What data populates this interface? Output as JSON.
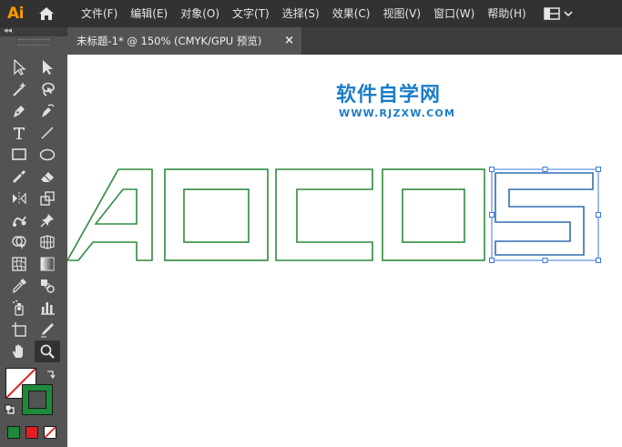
{
  "app": {
    "logo_text": "Ai",
    "brand_color": "#FF9A00"
  },
  "menu": {
    "items": [
      "文件(F)",
      "编辑(E)",
      "对象(O)",
      "文字(T)",
      "选择(S)",
      "效果(C)",
      "视图(V)",
      "窗口(W)",
      "帮助(H)"
    ]
  },
  "toolbar": {
    "icons": [
      "home-icon",
      "workspace-switcher-icon",
      "chevron-down-icon"
    ]
  },
  "document": {
    "tab_title": "未标题-1* @ 150% (CMYK/GPU 预览)",
    "close_glyph": "×"
  },
  "watermark": {
    "title": "软件自学网",
    "url": "WWW.RJZXW.COM",
    "color": "#1B7DC9"
  },
  "artwork": {
    "outline_color": "#2E8B3E",
    "selection_color": "#3A78D6"
  },
  "tools": [
    "selection-tool-icon",
    "direct-selection-tool-icon",
    "magic-wand-tool-icon",
    "lasso-tool-icon",
    "pen-tool-icon",
    "curvature-tool-icon",
    "type-tool-icon",
    "line-tool-icon",
    "rectangle-tool-icon",
    "ellipse-tool-icon",
    "paintbrush-tool-icon",
    "eraser-tool-icon",
    "reflect-tool-icon",
    "scale-tool-icon",
    "puppet-warp-tool-icon",
    "pin-tool-icon",
    "shape-builder-tool-icon",
    "perspective-grid-tool-icon",
    "mesh-tool-icon",
    "gradient-tool-icon",
    "eyedropper-tool-icon",
    "blend-tool-icon",
    "symbol-sprayer-tool-icon",
    "column-graph-tool-icon",
    "artboard-tool-icon",
    "slice-tool-icon",
    "hand-tool-icon",
    "zoom-tool-icon"
  ],
  "swatches": {
    "fill": "none",
    "stroke": "#1E8A3A",
    "mode_colors": [
      "#1E8A3A",
      "#E02020",
      "none"
    ]
  }
}
